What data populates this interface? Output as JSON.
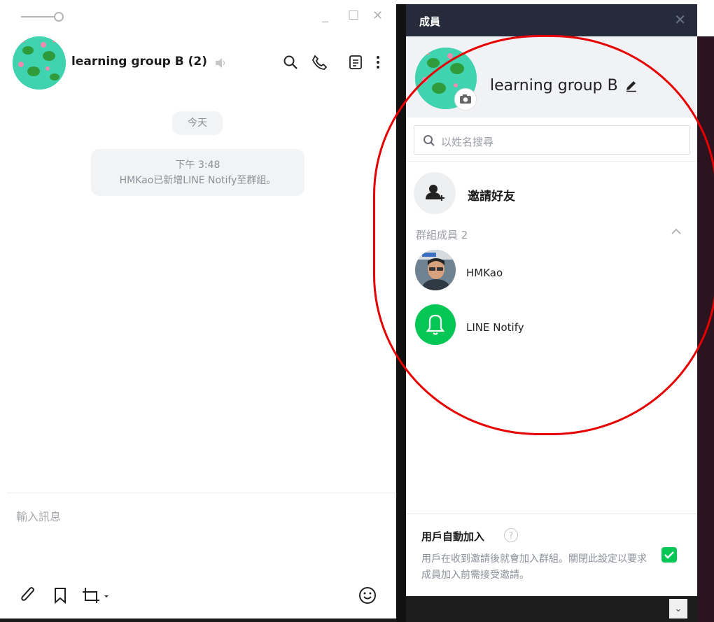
{
  "chat": {
    "title": "learning group B (2)",
    "date_separator": "今天",
    "system_message": {
      "time": "下午 3:48",
      "text": "HMKao已新增LINE Notify至群組。"
    },
    "input_placeholder": "輸入訊息",
    "window_controls": {
      "minimize": "_",
      "maximize": "☐",
      "close": "✕"
    }
  },
  "panel": {
    "header_title": "成員",
    "group_name": "learning group B",
    "search_placeholder": "以姓名搜尋",
    "invite_label": "邀請好友",
    "members_label": "群組成員 2",
    "members": [
      {
        "name": "HMKao"
      },
      {
        "name": "LINE Notify"
      }
    ],
    "auto_join": {
      "title": "用戶自動加入",
      "description": "用戶在收到邀請後就會加入群組。關閉此設定以要求成員加入前需接受邀請。",
      "checked": true
    }
  },
  "colors": {
    "panel_header": "#252b3b",
    "accent_green": "#06c755",
    "avatar_teal": "#3fd3b0",
    "annotation_red": "#e60000"
  },
  "icons": [
    "pin-icon",
    "speaker-icon",
    "search-icon",
    "phone-icon",
    "notes-icon",
    "more-icon",
    "paperclip-icon",
    "bookmark-icon",
    "crop-icon",
    "emoji-icon",
    "camera-icon",
    "edit-icon",
    "add-friend-icon",
    "chevron-up-icon",
    "bell-icon",
    "help-icon",
    "check-icon"
  ]
}
